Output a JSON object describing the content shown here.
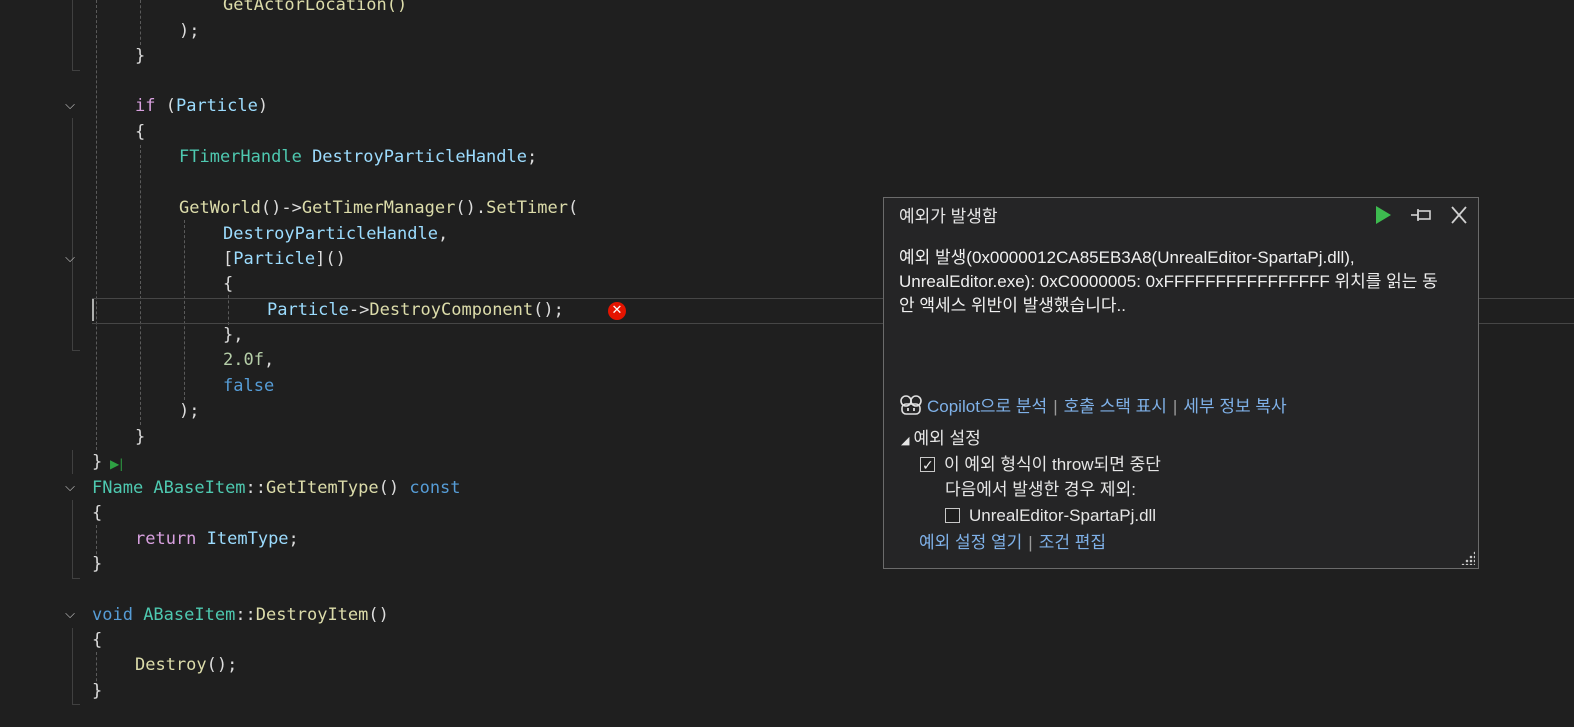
{
  "code": {
    "l1": "GetActorLocation()",
    "l2": ");",
    "l3": "}",
    "l5_kw": "if",
    "l5_rest_a": " (",
    "l5_var": "Particle",
    "l5_rest_b": ")",
    "l6": "{",
    "l7_type": "FTimerHandle",
    "l7_var": " DestroyParticleHandle",
    "l7_end": ";",
    "l9_fn1": "GetWorld",
    "l9_p1": "()->",
    "l9_fn2": "GetTimerManager",
    "l9_p2": "().",
    "l9_fn3": "SetTimer",
    "l9_p3": "(",
    "l10_var": "DestroyParticleHandle",
    "l10_p": ",",
    "l11_a": "[",
    "l11_var": "Particle",
    "l11_b": "]()",
    "l12": "{",
    "l13_var": "Particle",
    "l13_p1": "->",
    "l13_fn": "DestroyComponent",
    "l13_p2": "();",
    "l14": "},",
    "l15_num": "2.0f",
    "l15_p": ",",
    "l16_kw": "false",
    "l17": ");",
    "l18": "}",
    "l19": "}",
    "l20_type": "FName",
    "l20_cls": " ABaseItem",
    "l20_p1": "::",
    "l20_fn": "GetItemType",
    "l20_p2": "() ",
    "l20_kw": "const",
    "l21": "{",
    "l22_kw": "return",
    "l22_var": " ItemType",
    "l22_p": ";",
    "l23": "}",
    "l25_kw": "void",
    "l25_cls": " ABaseItem",
    "l25_p1": "::",
    "l25_fn": "DestroyItem",
    "l25_p2": "()",
    "l26": "{",
    "l27_fn": "Destroy",
    "l27_p": "();",
    "l28": "}"
  },
  "exception_popup": {
    "title": "예외가 발생함",
    "message_line1": "예외 발생(0x0000012CA85EB3A8(UnrealEditor-SpartaPj.dll),",
    "message_line2": "UnrealEditor.exe): 0xC0000005: 0xFFFFFFFFFFFFFFFF 위치를 읽는 동",
    "message_line3": "안 액세스 위반이 발생했습니다..",
    "link_copilot": "Copilot으로 분석",
    "link_callstack": "호출 스택 표시",
    "link_copy": "세부 정보 복사",
    "settings_header": "예외 설정",
    "break_checkbox_label": "이 예외 형식이 throw되면 중단",
    "except_label": "다음에서 발생한 경우 제외:",
    "dll_checkbox_label": "UnrealEditor-SpartaPj.dll",
    "break_checked": true,
    "dll_checked": false,
    "link_open_settings": "예외 설정 열기",
    "link_edit_conditions": "조건 편집",
    "continue_color": "#3dbb4f",
    "link_color": "#7fb1e8"
  }
}
